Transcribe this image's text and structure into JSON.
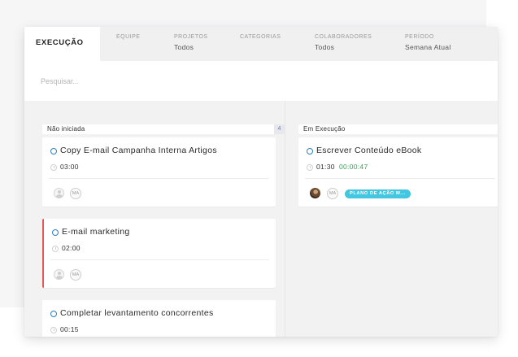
{
  "tabs": {
    "active": "EXECUÇÃO",
    "items": [
      {
        "label": "EQUIPE",
        "value": ""
      },
      {
        "label": "PROJETOS",
        "value": "Todos"
      },
      {
        "label": "CATEGORIAS",
        "value": ""
      },
      {
        "label": "COLABORADORES",
        "value": "Todos"
      },
      {
        "label": "PERÍODO",
        "value": "Semana Atual"
      }
    ]
  },
  "search": {
    "placeholder": "Pesquisar..."
  },
  "columns": [
    {
      "title": "Não iniciada",
      "count": "4",
      "cards": [
        {
          "title": "Copy E-mail Campanha Interna Artigos",
          "time": "03:00",
          "assignee_initials": "MA"
        },
        {
          "title": "E-mail marketing",
          "time": "02:00",
          "assignee_initials": "MA",
          "flagged": true
        },
        {
          "title": "Completar levantamento concorrentes",
          "time": "00:15"
        }
      ]
    },
    {
      "title": "Em Execução",
      "cards": [
        {
          "title": "Escrever Conteúdo eBook",
          "time": "01:30",
          "elapsed": "00:00:47",
          "assignee_initials": "MA",
          "tag": "PLANO DE AÇÃO M..."
        }
      ]
    }
  ],
  "colors": {
    "status_dot": "#2a7fc8",
    "flag": "#e05a5a",
    "elapsed": "#3aa05a",
    "tag": "#45c6e0"
  }
}
